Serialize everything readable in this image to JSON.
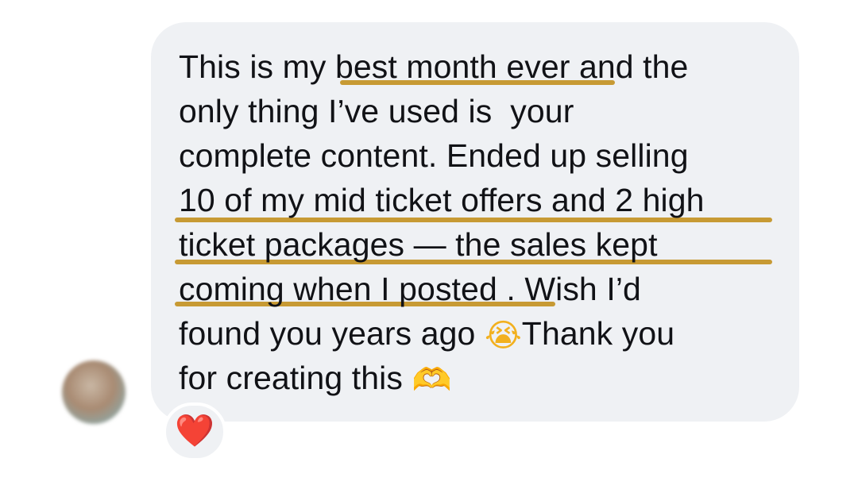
{
  "message": {
    "lines": [
      "This is my best month ever and the",
      "only thing I’ve used is  your",
      "complete content. Ended up selling",
      "10 of my mid ticket offers and 2 high",
      "ticket packages — the sales kept",
      "coming when I posted . Wish I’d",
      "found you years ago",
      "Thank you",
      "for creating this"
    ],
    "emoji_crying": "😭",
    "emoji_heart_hands": "🫶",
    "underline_color": "#c79a34",
    "bubble_color": "#eff1f4"
  },
  "reaction": {
    "emoji": "❤️",
    "icon": "red-heart-icon",
    "color": "#e3172b"
  },
  "sender": {
    "avatar_icon": "blurred-avatar"
  }
}
